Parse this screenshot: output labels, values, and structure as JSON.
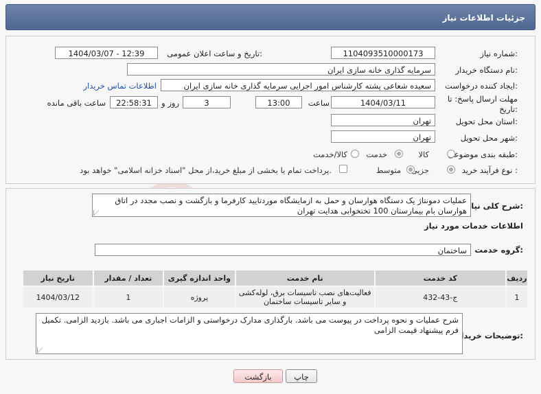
{
  "header": {
    "title": "جزئیات اطلاعات نیاز"
  },
  "form": {
    "need_number_label": "شماره نیاز:",
    "need_number": "1104093510000173",
    "announce_datetime_label": "تاریخ و ساعت اعلان عمومی:",
    "announce_datetime": "1404/03/07 - 12:39",
    "buyer_org_label": "نام دستگاه خریدار:",
    "buyer_org": "سرمایه گذاری خانه سازی ایران",
    "creator_label": "ایجاد کننده درخواست:",
    "creator": "سعیده شعاعی پشته کارشناس امور اجرایی سرمایه گذاری خانه سازی ایران",
    "contact_link": "اطلاعات تماس خریدار",
    "deadline_label_line1": "مهلت ارسال پاسخ: تا",
    "deadline_label_line2": "تاریخ:",
    "deadline_date": "1404/03/11",
    "time_label": "ساعت",
    "deadline_time": "13:00",
    "days_value": "3",
    "days_label": "روز و",
    "remaining_time": "22:58:31",
    "remaining_label": "ساعت باقی مانده",
    "province_label": "استان محل تحویل:",
    "province": "تهران",
    "city_label": "شهر محل تحویل:",
    "city": "تهران",
    "category_label": "طبقه بندی موضوعی:",
    "category_options": [
      "کالا",
      "خدمت",
      "کالا/خدمت"
    ],
    "category_selected": "خدمت",
    "process_label": "نوع فرآیند خرید :",
    "process_options": [
      "جزیی",
      "متوسط"
    ],
    "process_selected": "جزیی",
    "treasury_note": "پرداخت تمام یا بخشی از مبلغ خرید،از محل \"اسناد خزانه اسلامی\" خواهد بود."
  },
  "summary": {
    "label": "شرح کلی نیاز:",
    "text": "عملیات دمونتاژ یک دستگاه هوارسان و حمل به ازمایشگاه موردتایید کارفرما و بازگشت و نصب مجدد در اتاق هوارسان بام بیمارستان 100 تختخوابی هدایت تهران"
  },
  "services": {
    "section_title": "اطلاعات خدمات مورد نیاز",
    "group_label": "گروه خدمت:",
    "group_value": "ساختمان",
    "columns": [
      "ردیف",
      "کد خدمت",
      "نام خدمت",
      "واحد اندازه گیری",
      "تعداد / مقدار",
      "تاریخ نیاز"
    ],
    "rows": [
      {
        "index": "1",
        "code": "ج-43-432",
        "name": "فعالیت‌های نصب تاسیسات برق، لوله‌کشی و سایر تاسیسات ساختمان",
        "unit": "پروژه",
        "qty": "1",
        "date": "1404/03/12"
      }
    ]
  },
  "buyer_notes": {
    "label": "توضیحات خریدار:",
    "text": "شرح عملیات و نحوه پرداخت در پیوست می باشد. بارگذاری مدارک درخواستی و الزامات اجباری می باشد.  بازدید الزامی. تکمیل فرم پیشنهاد قیمت الزامی"
  },
  "buttons": {
    "print": "چاپ",
    "back": "بازگشت"
  },
  "watermark": {
    "text": "AriaTender.neT"
  }
}
